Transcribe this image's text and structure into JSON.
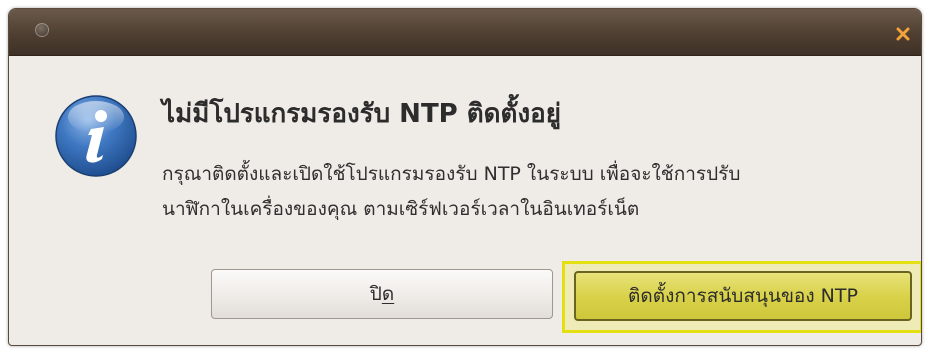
{
  "dialog": {
    "heading": "ไม่มีโปรแกรมรองรับ NTP ติดตั้งอยู่",
    "message_line1": "กรุณาติดตั้งและเปิดใช้โปรแกรมรองรับ NTP ในระบบ เพื่อจะใช้การปรับ",
    "message_line2": "นาฬิกาในเครื่องของคุณ ตามเซิร์ฟเวอร์เวลาในอินเทอร์เน็ต",
    "info_icon": "info-icon",
    "close_icon": "close-icon"
  },
  "buttons": {
    "close_prefix": "ปิ",
    "close_mnemonic": "ด",
    "install_label": "ติดตั้งการสนับสนุนของ NTP"
  },
  "colors": {
    "titlebar": "#4f3f32",
    "dialog_bg": "#efebe7",
    "highlight": "#e4df10",
    "close_x": "#f3a33a",
    "info_blue": "#2b64ad"
  }
}
